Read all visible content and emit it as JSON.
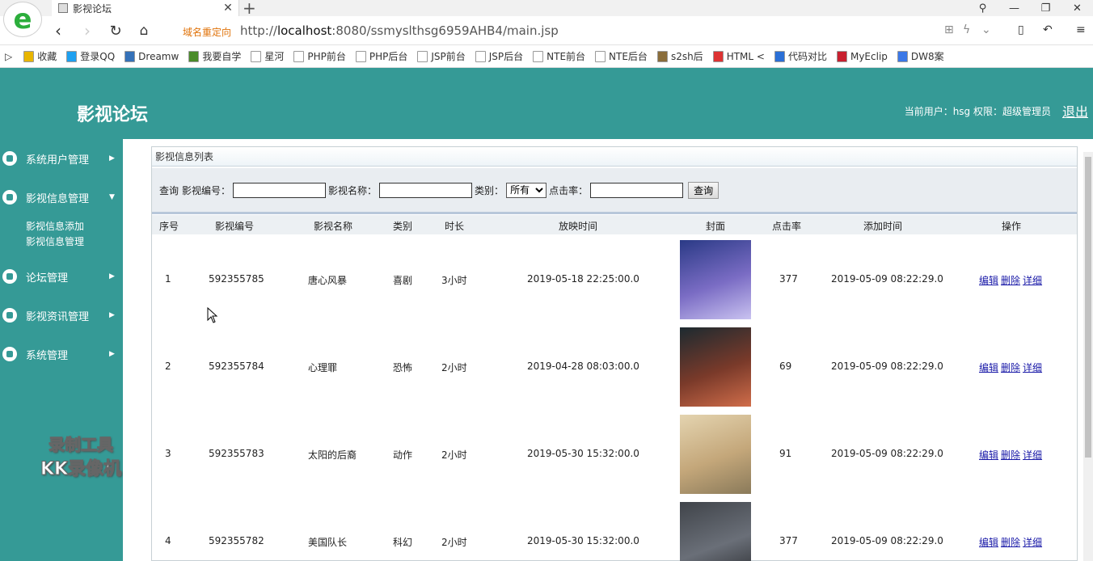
{
  "browser": {
    "tab_title": "影视论坛",
    "redirect_label": "域名重定向",
    "url_prefix": "http://",
    "url_host": "localhost",
    "url_rest": ":8080/ssmyslthsg6959AHB4/main.jsp"
  },
  "bookmarks": [
    {
      "label": "收藏",
      "icon": "star-icon"
    },
    {
      "label": "登录QQ",
      "icon": "qq-icon"
    },
    {
      "label": "Dreamw",
      "icon": "dreamweaver-icon"
    },
    {
      "label": "我要自学",
      "icon": "video-icon"
    },
    {
      "label": "星河",
      "icon": "page-icon"
    },
    {
      "label": "PHP前台",
      "icon": "page-icon"
    },
    {
      "label": "PHP后台",
      "icon": "page-icon"
    },
    {
      "label": "JSP前台",
      "icon": "page-icon"
    },
    {
      "label": "JSP后台",
      "icon": "page-icon"
    },
    {
      "label": "NTE前台",
      "icon": "page-icon"
    },
    {
      "label": "NTE后台",
      "icon": "page-icon"
    },
    {
      "label": "s2sh后",
      "icon": "image-icon"
    },
    {
      "label": "HTML <",
      "icon": "html-icon"
    },
    {
      "label": "代码对比",
      "icon": "compare-icon"
    },
    {
      "label": "MyEclip",
      "icon": "myeclipse-icon"
    },
    {
      "label": "DW8案",
      "icon": "paw-icon"
    }
  ],
  "header": {
    "title": "影视论坛",
    "user_info": "当前用户：hsg  权限：超级管理员",
    "logout": "退出"
  },
  "sidebar": {
    "items": [
      {
        "label": "系统用户管理",
        "icon": "user-icon"
      },
      {
        "label": "影视信息管理",
        "icon": "users-gear-icon"
      },
      {
        "label": "论坛管理",
        "icon": "forum-icon"
      },
      {
        "label": "影视资讯管理",
        "icon": "gear-icon"
      },
      {
        "label": "系统管理",
        "icon": "chart-icon"
      }
    ],
    "submenu": [
      "影视信息添加",
      "影视信息管理"
    ],
    "watermark": [
      "录制工具",
      "KK录像机"
    ]
  },
  "panel": {
    "title": "影视信息列表",
    "search": {
      "query_label": "查询",
      "code_label": "影视编号：",
      "name_label": "影视名称：",
      "category_label": "类别：",
      "category_value": "所有",
      "clicks_label": "点击率：",
      "button": "查询"
    },
    "columns": [
      "序号",
      "影视编号",
      "影视名称",
      "类别",
      "时长",
      "放映时间",
      "封面",
      "点击率",
      "添加时间",
      "操作"
    ],
    "rows": [
      {
        "no": "1",
        "code": "592355785",
        "name": "唐心风暴",
        "category": "喜剧",
        "duration": "3小时",
        "show_time": "2019-05-18 22:25:00.0",
        "clicks": "377",
        "added": "2019-05-09 08:22:29.0"
      },
      {
        "no": "2",
        "code": "592355784",
        "name": "心理罪",
        "category": "恐怖",
        "duration": "2小时",
        "show_time": "2019-04-28 08:03:00.0",
        "clicks": "69",
        "added": "2019-05-09 08:22:29.0"
      },
      {
        "no": "3",
        "code": "592355783",
        "name": "太阳的后裔",
        "category": "动作",
        "duration": "2小时",
        "show_time": "2019-05-30 15:32:00.0",
        "clicks": "91",
        "added": "2019-05-09 08:22:29.0"
      },
      {
        "no": "4",
        "code": "592355782",
        "name": "美国队长",
        "category": "科幻",
        "duration": "2小时",
        "show_time": "2019-05-30 15:32:00.0",
        "clicks": "377",
        "added": "2019-05-09 08:22:29.0"
      }
    ],
    "ops": {
      "edit": "编辑",
      "delete": "删除",
      "detail": "详细"
    }
  },
  "colors": {
    "accent": "#359a96",
    "link": "#1a1aa8"
  }
}
